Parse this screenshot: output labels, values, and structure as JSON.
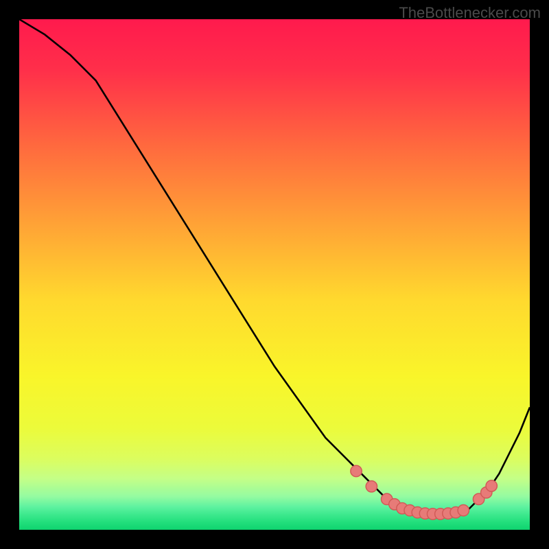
{
  "attribution": "TheBottlenecker.com",
  "chart_data": {
    "type": "line",
    "title": "",
    "xlabel": "",
    "ylabel": "",
    "xlim": [
      0,
      100
    ],
    "ylim": [
      0,
      100
    ],
    "series": [
      {
        "name": "curve",
        "x": [
          0,
          5,
          10,
          15,
          20,
          25,
          30,
          35,
          40,
          45,
          50,
          55,
          60,
          65,
          70,
          72,
          74,
          76,
          78,
          80,
          82,
          84,
          86,
          88,
          90,
          92,
          94,
          96,
          98,
          100
        ],
        "y": [
          100,
          97,
          93,
          88,
          80,
          72,
          64,
          56,
          48,
          40,
          32,
          25,
          18,
          13,
          8,
          6,
          5,
          4,
          3,
          3,
          3,
          3,
          3,
          4,
          6,
          8,
          11,
          15,
          19,
          24
        ]
      }
    ],
    "markers": {
      "name": "dots",
      "x": [
        66,
        69,
        72,
        73.5,
        75,
        76.5,
        78,
        79.5,
        81,
        82.5,
        84,
        85.5,
        87,
        90,
        91.5,
        92.5
      ],
      "y": [
        11.5,
        8.5,
        6,
        5,
        4.2,
        3.8,
        3.4,
        3.2,
        3.1,
        3.1,
        3.2,
        3.4,
        3.8,
        6,
        7.3,
        8.6
      ]
    },
    "colors": {
      "curve": "#000000",
      "marker_fill": "#e77b78",
      "marker_stroke": "#d15a57"
    },
    "background_gradient": {
      "stops": [
        {
          "offset": 0.0,
          "color": "#ff1a4d"
        },
        {
          "offset": 0.1,
          "color": "#ff2f4a"
        },
        {
          "offset": 0.25,
          "color": "#ff6a3e"
        },
        {
          "offset": 0.4,
          "color": "#ffa236"
        },
        {
          "offset": 0.55,
          "color": "#ffd92e"
        },
        {
          "offset": 0.7,
          "color": "#f9f52a"
        },
        {
          "offset": 0.8,
          "color": "#ecfb3a"
        },
        {
          "offset": 0.86,
          "color": "#dcfd5e"
        },
        {
          "offset": 0.9,
          "color": "#c4ff87"
        },
        {
          "offset": 0.935,
          "color": "#94fba1"
        },
        {
          "offset": 0.955,
          "color": "#5ef2a0"
        },
        {
          "offset": 0.97,
          "color": "#3de98e"
        },
        {
          "offset": 0.985,
          "color": "#22df7c"
        },
        {
          "offset": 1.0,
          "color": "#0fd46f"
        }
      ]
    }
  }
}
